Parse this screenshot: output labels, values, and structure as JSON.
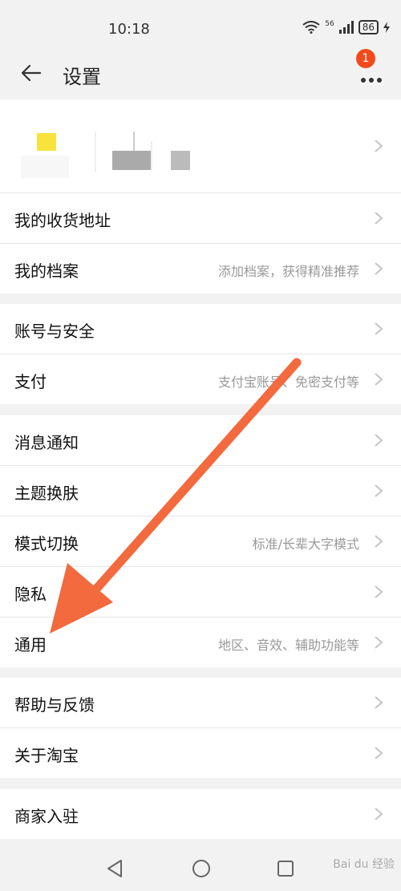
{
  "status": {
    "time": "10:18",
    "signal_label": "56",
    "battery": "86"
  },
  "header": {
    "title": "设置",
    "badge_count": "1"
  },
  "sections": [
    {
      "rows": [
        {
          "label": "我的收货地址",
          "hint": ""
        },
        {
          "label": "我的档案",
          "hint": "添加档案，获得精准推荐"
        }
      ]
    },
    {
      "rows": [
        {
          "label": "账号与安全",
          "hint": ""
        },
        {
          "label": "支付",
          "hint": "支付宝账号、免密支付等"
        }
      ]
    },
    {
      "rows": [
        {
          "label": "消息通知",
          "hint": ""
        },
        {
          "label": "主题换肤",
          "hint": ""
        },
        {
          "label": "模式切换",
          "hint": "标准/长辈大字模式"
        },
        {
          "label": "隐私",
          "hint": ""
        },
        {
          "label": "通用",
          "hint": "地区、音效、辅助功能等"
        }
      ]
    },
    {
      "rows": [
        {
          "label": "帮助与反馈",
          "hint": ""
        },
        {
          "label": "关于淘宝",
          "hint": ""
        }
      ]
    },
    {
      "rows": [
        {
          "label": "商家入驻",
          "hint": ""
        }
      ]
    }
  ],
  "watermark": "Bai du 经验",
  "colors": {
    "accent": "#f24a1d",
    "arrow": "#f26a3d"
  }
}
